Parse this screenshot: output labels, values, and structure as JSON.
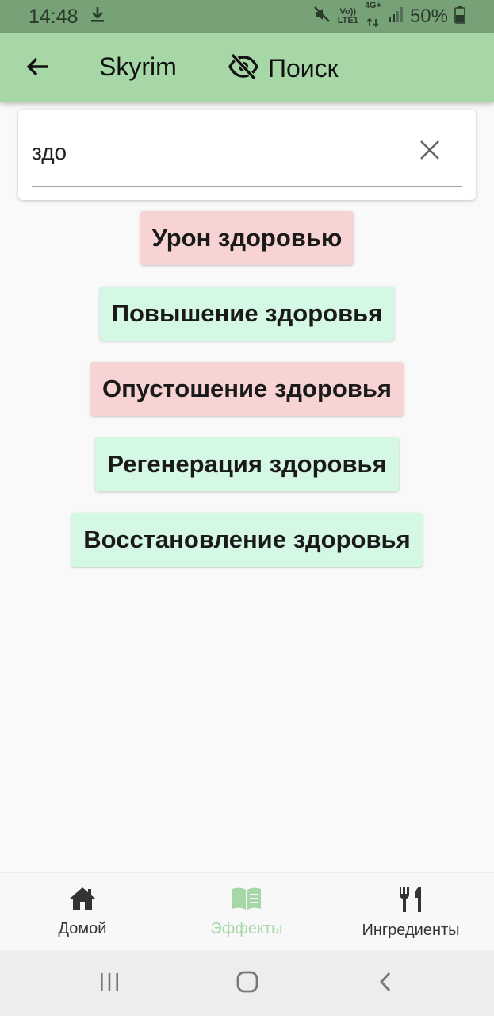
{
  "status_bar": {
    "time": "14:48",
    "volte_line1": "Vo))",
    "volte_line2": "LTE1",
    "network_line1": "4G+",
    "battery": "50%"
  },
  "app_bar": {
    "title": "Skyrim",
    "search_label": "Поиск"
  },
  "search": {
    "value": "здо"
  },
  "results": [
    {
      "label": "Урон здоровью",
      "color": "#f8d3d3"
    },
    {
      "label": "Повышение здоровья",
      "color": "#d4f8e3"
    },
    {
      "label": "Опустошение здоровья",
      "color": "#f8d3d3"
    },
    {
      "label": "Регенерация здоровья",
      "color": "#d4f8e3"
    },
    {
      "label": "Восстановление здоровья",
      "color": "#d4f8e3"
    }
  ],
  "bottom_nav": {
    "items": [
      {
        "label": "Домой",
        "icon": "home-icon"
      },
      {
        "label": "Эффекты",
        "icon": "book-icon"
      },
      {
        "label": "Ингредиенты",
        "icon": "utensils-icon"
      }
    ],
    "active_color": "#a7d7a7",
    "inactive_color": "#333333"
  },
  "colors": {
    "app_bar": "#a7d7a7",
    "status_bar": "#77a177",
    "harmful": "#f8d3d3",
    "beneficial": "#d4f8e3"
  }
}
